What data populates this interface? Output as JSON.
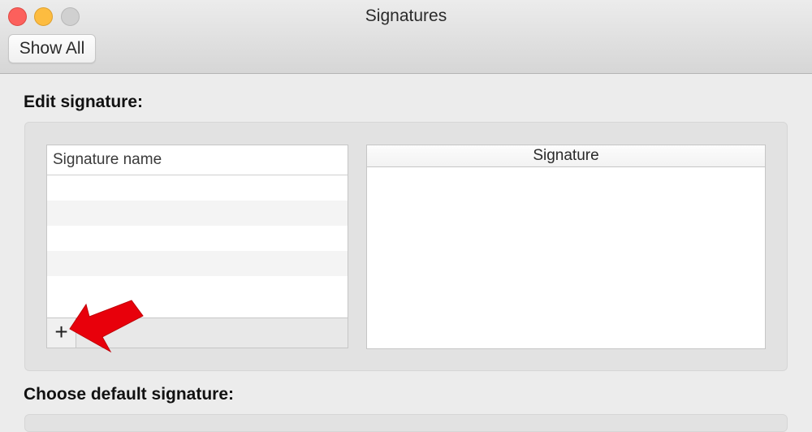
{
  "window": {
    "title": "Signatures",
    "show_all_label": "Show All"
  },
  "edit_section": {
    "title": "Edit signature:",
    "name_column_header": "Signature name",
    "signature_column_header": "Signature",
    "add_button_glyph": "+",
    "empty_rows": 6
  },
  "default_section": {
    "title": "Choose default signature:"
  },
  "colors": {
    "close": "#fc605c",
    "minimize": "#fdbc40",
    "zoom": "#d0d0d0",
    "annotation_arrow": "#e8000b"
  },
  "icons": [
    "close-icon",
    "minimize-icon",
    "zoom-icon",
    "plus-icon",
    "annotation-arrow"
  ]
}
